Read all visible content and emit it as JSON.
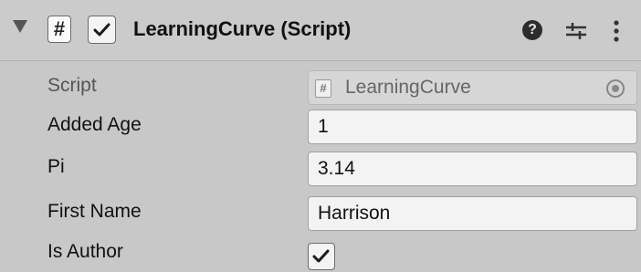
{
  "component": {
    "title": "LearningCurve (Script)",
    "enabled": true,
    "icon": "script-hash-icon",
    "header_icons": [
      "help-icon",
      "presets-icon",
      "context-menu-icon"
    ]
  },
  "fields": {
    "script": {
      "label": "Script",
      "value": "LearningCurve"
    },
    "added_age": {
      "label": "Added Age",
      "value": "1"
    },
    "pi": {
      "label": "Pi",
      "value": "3.14"
    },
    "first_name": {
      "label": "First Name",
      "value": "Harrison"
    },
    "is_author": {
      "label": "Is Author",
      "checked": true
    }
  }
}
